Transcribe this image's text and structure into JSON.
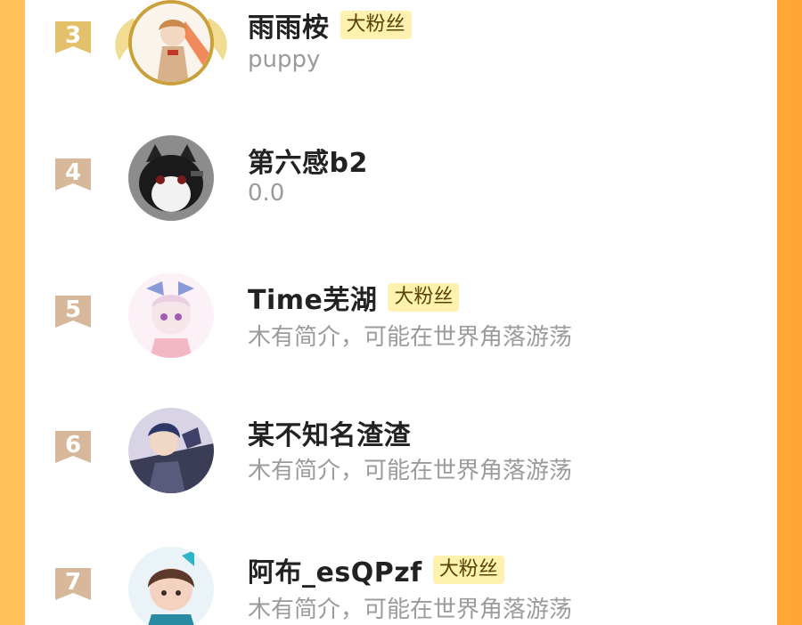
{
  "colors": {
    "background_gradient_start": "#ffc15a",
    "background_gradient_end": "#ffa534",
    "badge_bg": "#fff1b0",
    "rank_gold": "#e3c06a",
    "rank_bronze": "#d7b89a"
  },
  "ranking": {
    "items": [
      {
        "rank": "3",
        "name": "雨雨桉",
        "badge": "大粉丝",
        "bio": "puppy",
        "avatar_icon": "anime-girl-avatar",
        "frame": "gold-wings-frame",
        "rank_icon": "rank-ribbon-gold-icon"
      },
      {
        "rank": "4",
        "name": "第六感b2",
        "badge": "",
        "bio": "0.0",
        "avatar_icon": "cat-avatar",
        "rank_icon": "rank-ribbon-icon"
      },
      {
        "rank": "5",
        "name": "Time芜湖",
        "badge": "大粉丝",
        "bio": "木有简介，可能在世界角落游荡",
        "avatar_icon": "anime-girl-bow-avatar",
        "rank_icon": "rank-ribbon-icon"
      },
      {
        "rank": "6",
        "name": "某不知名渣渣",
        "badge": "",
        "bio": "木有简介，可能在世界角落游荡",
        "avatar_icon": "anime-boy-avatar",
        "rank_icon": "rank-ribbon-icon"
      },
      {
        "rank": "7",
        "name": "阿布_esQPzf",
        "badge": "大粉丝",
        "bio": "木有简介，可能在世界角落游荡",
        "avatar_icon": "anime-girl-blue-avatar",
        "rank_icon": "rank-ribbon-icon"
      }
    ]
  }
}
